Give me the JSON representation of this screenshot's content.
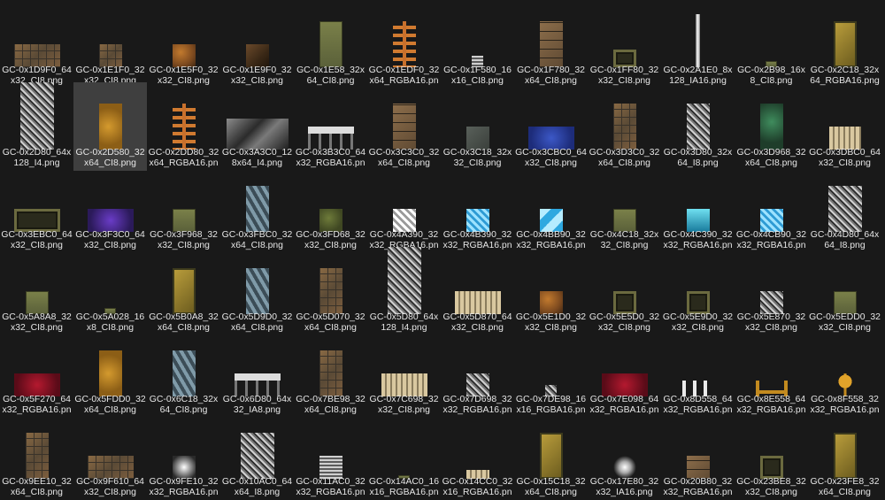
{
  "files": [
    {
      "name": "GC-0x1D9F0_64x32_CI8.png",
      "w": 52,
      "h": 26,
      "style": "brick"
    },
    {
      "name": "GC-0x1E1F0_32x32_CI8.png",
      "w": 26,
      "h": 26,
      "style": "brick"
    },
    {
      "name": "GC-0x1E5F0_32x32_CI8.png",
      "w": 26,
      "h": 26,
      "style": "rust"
    },
    {
      "name": "GC-0x1E9F0_32x32_CI8.png",
      "w": 26,
      "h": 26,
      "style": "dark"
    },
    {
      "name": "GC-0x1E58_32x64_CI8.png",
      "w": 26,
      "h": 52,
      "style": "olive"
    },
    {
      "name": "GC-0x1EDF0_32x64_RGBA16.png",
      "w": 26,
      "h": 52,
      "style": "ladder"
    },
    {
      "name": "GC-0x1F580_16x16_CI8.png",
      "w": 13,
      "h": 13,
      "style": "spring"
    },
    {
      "name": "GC-0x1F780_32x64_CI8.png",
      "w": 26,
      "h": 52,
      "style": "stone"
    },
    {
      "name": "GC-0x1FF80_32x32_CI8.png",
      "w": 26,
      "h": 20,
      "style": "frame"
    },
    {
      "name": "GC-0x2A1E0_8x128_IA16.png",
      "w": 5,
      "h": 60,
      "style": "bar"
    },
    {
      "name": "GC-0x2B98_16x8_CI8.png",
      "w": 13,
      "h": 7,
      "style": "olive"
    },
    {
      "name": "GC-0x2C18_32x64_RGBA16.png",
      "w": 26,
      "h": 52,
      "style": "gold"
    },
    {
      "name": "GC-0x2D80_64x128_I4.png",
      "w": 38,
      "h": 76,
      "style": "gray"
    },
    {
      "name": "GC-0x2D580_32x64_CI8.png",
      "w": 26,
      "h": 52,
      "style": "amber",
      "selected": true
    },
    {
      "name": "GC-0x2DD80_32x64_RGBA16.png",
      "w": 26,
      "h": 52,
      "style": "ladder"
    },
    {
      "name": "GC-0x3A3C0_128x64_I4.png",
      "w": 70,
      "h": 35,
      "style": "leaf"
    },
    {
      "name": "GC-0x3B3C0_64x32_RGBA16.png",
      "w": 52,
      "h": 26,
      "style": "rail"
    },
    {
      "name": "GC-0x3C3C0_32x64_CI8.png",
      "w": 26,
      "h": 52,
      "style": "stone"
    },
    {
      "name": "GC-0x3C18_32x32_CI8.png",
      "w": 26,
      "h": 26,
      "style": "slate"
    },
    {
      "name": "GC-0x3CBC0_64x32_CI8.png",
      "w": 52,
      "h": 26,
      "style": "blue"
    },
    {
      "name": "GC-0x3D3C0_32x64_CI8.png",
      "w": 26,
      "h": 52,
      "style": "brick"
    },
    {
      "name": "GC-0x3D80_32x64_I8.png",
      "w": 26,
      "h": 52,
      "style": "gray"
    },
    {
      "name": "GC-0x3D968_32x64_CI8.png",
      "w": 26,
      "h": 52,
      "style": "green"
    },
    {
      "name": "GC-0x3DBC0_64x32_CI8.png",
      "w": 36,
      "h": 26,
      "style": "tan"
    },
    {
      "name": "GC-0x3EBC0_64x32_CI8.png",
      "w": 52,
      "h": 26,
      "style": "frame"
    },
    {
      "name": "GC-0x3F3C0_64x32_CI8.png",
      "w": 52,
      "h": 26,
      "style": "purple"
    },
    {
      "name": "GC-0x3F968_32x32_CI8.png",
      "w": 26,
      "h": 26,
      "style": "olive"
    },
    {
      "name": "GC-0x3FBC0_32x64_CI8.png",
      "w": 26,
      "h": 52,
      "style": "scale"
    },
    {
      "name": "GC-0x3FD68_32x32_CI8.png",
      "w": 26,
      "h": 26,
      "style": "moss"
    },
    {
      "name": "GC-0x4A390_32x32_RGBA16.png",
      "w": 26,
      "h": 26,
      "style": "white"
    },
    {
      "name": "GC-0x4B390_32x32_RGBA16.png",
      "w": 26,
      "h": 26,
      "style": "ice"
    },
    {
      "name": "GC-0x4BB90_32x32_RGBA16.png",
      "w": 26,
      "h": 26,
      "style": "tri"
    },
    {
      "name": "GC-0x4C18_32x32_CI8.png",
      "w": 26,
      "h": 26,
      "style": "olive"
    },
    {
      "name": "GC-0x4C390_32x32_RGBA16.png",
      "w": 26,
      "h": 26,
      "style": "cyan"
    },
    {
      "name": "GC-0x4CB90_32x32_RGBA16.png",
      "w": 26,
      "h": 26,
      "style": "ice"
    },
    {
      "name": "GC-0x4D80_64x64_I8.png",
      "w": 38,
      "h": 52,
      "style": "gray"
    },
    {
      "name": "GC-0x5A8A8_32x32_CI8.png",
      "w": 26,
      "h": 26,
      "style": "olive"
    },
    {
      "name": "GC-0x5A028_16x8_CI8.png",
      "w": 13,
      "h": 7,
      "style": "olive"
    },
    {
      "name": "GC-0x5B0A8_32x64_CI8.png",
      "w": 26,
      "h": 52,
      "style": "gold"
    },
    {
      "name": "GC-0x5D9D0_32x64_CI8.png",
      "w": 26,
      "h": 52,
      "style": "scale"
    },
    {
      "name": "GC-0x5D070_32x64_CI8.png",
      "w": 26,
      "h": 52,
      "style": "brick"
    },
    {
      "name": "GC-0x5D80_64x128_I4.png",
      "w": 38,
      "h": 76,
      "style": "gray"
    },
    {
      "name": "GC-0x5D870_64x32_CI8.png",
      "w": 52,
      "h": 26,
      "style": "tan"
    },
    {
      "name": "GC-0x5E1D0_32x32_CI8.png",
      "w": 26,
      "h": 26,
      "style": "rust"
    },
    {
      "name": "GC-0x5E5D0_32x32_CI8.png",
      "w": 26,
      "h": 26,
      "style": "frame"
    },
    {
      "name": "GC-0x5E9D0_32x32_CI8.png",
      "w": 26,
      "h": 26,
      "style": "frame"
    },
    {
      "name": "GC-0x5E870_32x32_CI8.png",
      "w": 26,
      "h": 26,
      "style": "gray"
    },
    {
      "name": "GC-0x5EDD0_32x32_CI8.png",
      "w": 26,
      "h": 26,
      "style": "olive"
    },
    {
      "name": "GC-0x5F270_64x32_RGBA16.png",
      "w": 52,
      "h": 26,
      "style": "red"
    },
    {
      "name": "GC-0x5FDD0_32x64_CI8.png",
      "w": 26,
      "h": 52,
      "style": "amber"
    },
    {
      "name": "GC-0x6C18_32x64_CI8.png",
      "w": 26,
      "h": 52,
      "style": "scale"
    },
    {
      "name": "GC-0x6D80_64x32_IA8.png",
      "w": 52,
      "h": 26,
      "style": "rail"
    },
    {
      "name": "GC-0x7BE98_32x64_CI8.png",
      "w": 26,
      "h": 52,
      "style": "brick"
    },
    {
      "name": "GC-0x7C698_32x32_CI8.png",
      "w": 52,
      "h": 26,
      "style": "tan"
    },
    {
      "name": "GC-0x7D698_32x32_RGBA16.png",
      "w": 26,
      "h": 26,
      "style": "gray"
    },
    {
      "name": "GC-0x7DE98_16x16_RGBA16.png",
      "w": 13,
      "h": 13,
      "style": "gray"
    },
    {
      "name": "GC-0x7E098_64x32_RGBA16.png",
      "w": 52,
      "h": 26,
      "style": "red"
    },
    {
      "name": "GC-0x8D558_64x32_RGBA16.png",
      "w": 36,
      "h": 18,
      "style": "posts"
    },
    {
      "name": "GC-0x8E558_64x32_RGBA16.png",
      "w": 36,
      "h": 18,
      "style": "goldU"
    },
    {
      "name": "GC-0x8F558_32x32_RGBA16.png",
      "w": 26,
      "h": 26,
      "style": "goldT"
    },
    {
      "name": "GC-0x9EE10_32x64_CI8.png",
      "w": 26,
      "h": 52,
      "style": "brick"
    },
    {
      "name": "GC-0x9F610_64x32_CI8.png",
      "w": 52,
      "h": 26,
      "style": "brick"
    },
    {
      "name": "GC-0x9FE10_32x32_RGBA16.png",
      "w": 26,
      "h": 26,
      "style": "radial"
    },
    {
      "name": "GC-0x10AC0_64x64_I8.png",
      "w": 38,
      "h": 52,
      "style": "gray"
    },
    {
      "name": "GC-0x11AC0_32x32_RGBA16.png",
      "w": 26,
      "h": 26,
      "style": "spring"
    },
    {
      "name": "GC-0x14AC0_16x16_RGBA16.png",
      "w": 13,
      "h": 4,
      "style": "olive"
    },
    {
      "name": "GC-0x14CC0_32x16_RGBA16.png",
      "w": 26,
      "h": 10,
      "style": "tan"
    },
    {
      "name": "GC-0x15C18_32x64_CI8.png",
      "w": 26,
      "h": 52,
      "style": "gold"
    },
    {
      "name": "GC-0x17E80_32x32_IA16.png",
      "w": 26,
      "h": 26,
      "style": "glow"
    },
    {
      "name": "GC-0x20B80_32x32_RGBA16.png",
      "w": 26,
      "h": 26,
      "style": "stone"
    },
    {
      "name": "GC-0x23BE8_32x32_CI8.png",
      "w": 26,
      "h": 26,
      "style": "frame"
    },
    {
      "name": "GC-0x23FE8_32x64_CI8.png",
      "w": 26,
      "h": 52,
      "style": "gold"
    }
  ],
  "colors": {
    "background": "#191919",
    "label": "#e6e6e6",
    "selection": "#3f3f3f"
  }
}
